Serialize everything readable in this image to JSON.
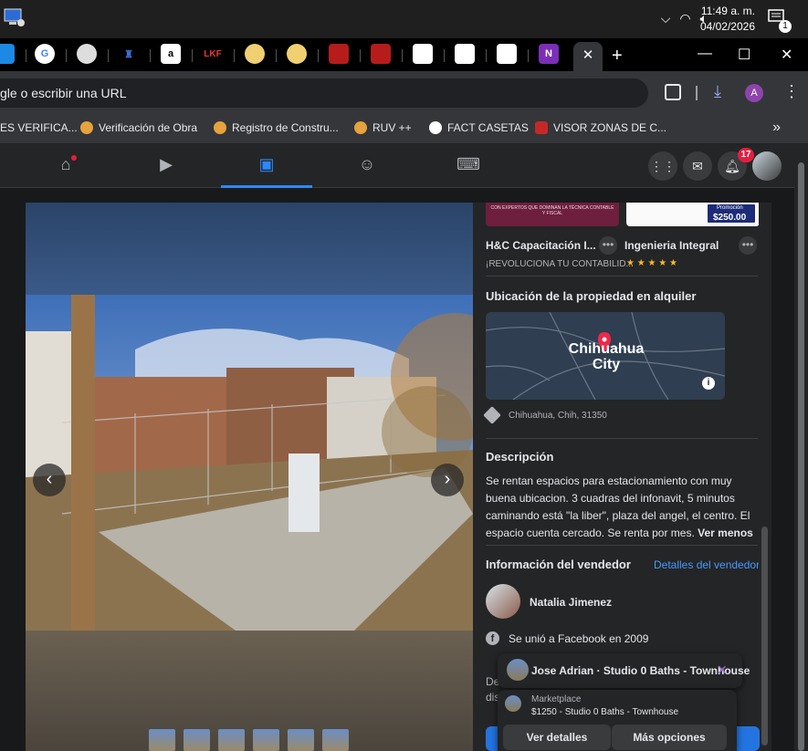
{
  "taskbar": {
    "time": "11:49 a. m.",
    "date": "04/02/2026",
    "notif_count": "1"
  },
  "browser": {
    "address_placeholder": "gle o escribir una URL",
    "profile_initial": "A",
    "bookmarks": [
      {
        "label": "ES VERIFICA..."
      },
      {
        "label": "Verificación de Obra"
      },
      {
        "label": "Registro de Constru..."
      },
      {
        "label": "RUV ++"
      },
      {
        "label": "FACT CASETAS"
      },
      {
        "label": "VISOR ZONAS DE C..."
      }
    ],
    "bookmarks_more": "»"
  },
  "fb_nav": {
    "notification_count": "17"
  },
  "listing": {
    "ad1_name": "H&C Capacitación I...",
    "ad1_tagline": "¡REVOLUCIONA TU CONTABILID...",
    "ad2_name": "Ingenieria Integral",
    "ad2_stars": "★ ★ ★ ★ ★",
    "ad2_price": "$250.00",
    "ad2_promo": "Promoción",
    "ad1_banner": "CON EXPERTOS QUE DOMINAN LA TÉCNICA CONTABLE Y FISCAL",
    "location_title": "Ubicación de la propiedad en alquiler",
    "map_city": "Chihuahua City",
    "address": "Chihuahua, Chih, 31350",
    "description_title": "Descripción",
    "description_text": "Se rentan espacios para estacionamiento con muy buena ubicacion. 3 cuadras del infonavit, 5 minutos caminando está \"la liber\", plaza del angel, el centro.  El espacio cuenta cercado. Se renta por mes.",
    "see_less": "Ver menos",
    "seller_title": "Información del vendedor",
    "seller_details_link": "Detalles del vendedor",
    "seller_name": "Natalia Jimenez",
    "seller_joined": "Se unió a Facebook en 2009",
    "partial_text_1": "De",
    "partial_text_2": "dis"
  },
  "chat": {
    "head_title": "Jose Adrian · Studio 0 Baths - Townhouse",
    "card_source": "Marketplace",
    "card_item": "$1250 - Studio 0 Baths - Townhouse",
    "btn_details": "Ver detalles",
    "btn_more": "Más opciones"
  }
}
